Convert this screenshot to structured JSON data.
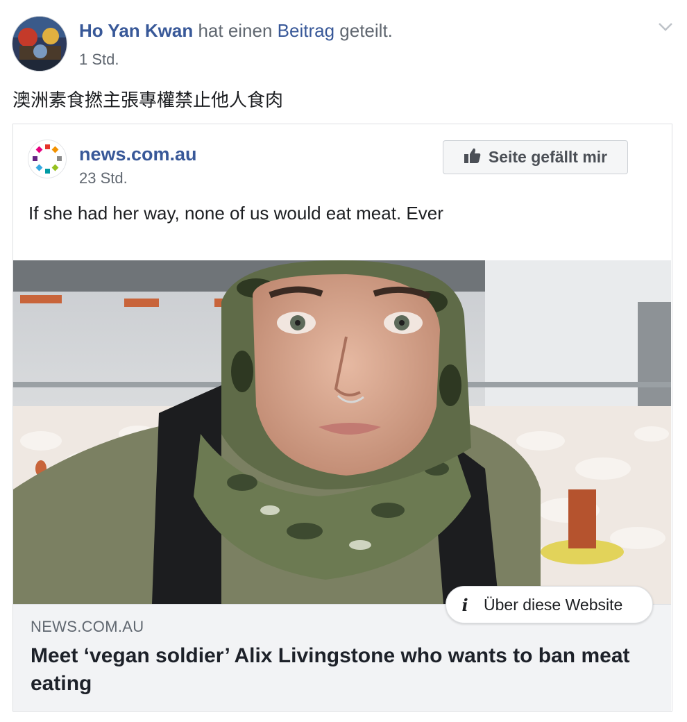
{
  "post": {
    "author": "Ho Yan Kwan",
    "action_text": " hat einen ",
    "object_link": "Beitrag",
    "action_suffix": " geteilt.",
    "time": "1 Std.",
    "text": "澳洲素食撚主張專權禁止他人食肉"
  },
  "shared_post": {
    "page_name": "news.com.au",
    "time": "23 Std.",
    "like_button_label": "Seite gefällt mir",
    "text": "If she had her way, none of us would eat meat. Ever"
  },
  "link_preview": {
    "info_label": "Über diese Website",
    "info_icon": "i",
    "domain": "NEWS.COM.AU",
    "title": "Meet ‘vegan soldier’ Alix Livingstone who wants to ban meat eating"
  },
  "colors": {
    "link_blue": "#385898",
    "caption_bg": "#f2f3f5"
  }
}
